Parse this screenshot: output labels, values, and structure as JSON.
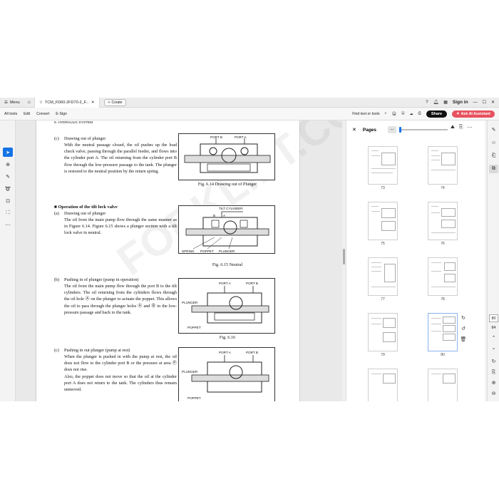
{
  "titlebar": {
    "menu_label": "Menu",
    "tab_title": "TCM_FD60-2FD70-2_F...",
    "create_label": "Create",
    "signin_label": "Sign in"
  },
  "toolbar": {
    "links": [
      "All tools",
      "Edit",
      "Convert",
      "E-Sign"
    ],
    "find_label": "Find text or tools",
    "share_label": "Share",
    "ai_label": "Ask AI Assistant"
  },
  "document": {
    "running_head": "6. HYDRAULIC SYSTEM",
    "watermark": "FORKLIFT.COM",
    "sections": [
      {
        "label": "(c)",
        "title": "Drawing out of plunger",
        "text": "With the neutral passage closed, the oil pushes up the load check valve, passing through the parallel feeder, and flows into the cylinder port A. The oil returning from the cylinder port B flow through the low-pressure passage to the tank. The plunger is restored to the neutral position by the return spring."
      },
      {
        "heading": "■ Operation of the tilt lock valve",
        "label": "(a)",
        "title": "Drawing out of plunger",
        "text": "The oil from the main pump flow through the port B to the tilt cylinders. The oil returning from the cylinders flows through the oil hole Ⓐ on the plunger to actuate the poppet. This allows the oil to pass through the plunger holes Ⓐ and Ⓑ to the low-pressure passage and back to the tank."
      },
      {
        "label": "(b)",
        "title": "Pushing in of plunger (pump in operation)",
        "text": "The oil from the main pump flow through the port B to the tilt cylinders. The oil returning from the cylinders flows through the oil hole Ⓐ on the plunger to actuate the poppet. This allows the oil to pass through the plunger holes Ⓐ and Ⓑ to the low-pressure passage and back to the tank."
      },
      {
        "label": "(c)",
        "title": "Pushing in out plunger (pump at rest)",
        "text": "When the plunger is pushed in with the pump at rest, the oil does not flow to the cylinder port B or the pressure at area Ⓟ does not rise.",
        "text2": "Also, the poppet does not move so that the oil at the cylinder port A does not return to the tank. The cylinders thus remain unmoved."
      }
    ],
    "section2_text": "The oil from the main pump flow through the same manner as in Figure 6.14. Figure 6.15 shows a plunger section with a tilt lock valve in neutral.",
    "figures": [
      {
        "caption": "Fig. 6.14  Drawing out of Plunger",
        "labels": [
          "PORT B",
          "PORT A"
        ]
      },
      {
        "caption": "Fig. 6.15  Neutral",
        "labels": [
          "TILT CYLINDER",
          "B",
          "A",
          "SPRING",
          "POPPET",
          "PLUNGER"
        ]
      },
      {
        "caption": "Fig. 6.16",
        "labels": [
          "PORT A",
          "PORT B",
          "PLUNGER",
          "POPPET"
        ]
      },
      {
        "caption": "",
        "labels": [
          "PORT A",
          "PORT B",
          "PLUNGER",
          "POPPET"
        ]
      }
    ]
  },
  "pages_panel": {
    "title": "Pages",
    "more_label": "...",
    "thumbnails": [
      "73",
      "74",
      "75",
      "76",
      "77",
      "78",
      "79",
      "80"
    ],
    "selected_page": "80"
  },
  "rightbar": {
    "current_page": "80",
    "total_pages": "84"
  }
}
